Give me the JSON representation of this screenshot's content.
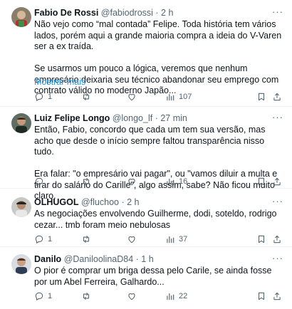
{
  "icons": {
    "reply": "reply-icon",
    "retweet": "retweet-icon",
    "like": "heart-icon",
    "views": "views-icon",
    "bookmark": "bookmark-icon",
    "share": "share-icon",
    "more": "more-icon"
  },
  "colors": {
    "text": "#0f1419",
    "secondary": "#536471",
    "link": "#1d9bf0",
    "divider": "#eff3f4"
  },
  "tweets": [
    {
      "name": "Fabio De Rossi",
      "handle": "@fabiodrossi",
      "sep": " · ",
      "time": "2 h",
      "paragraphs": [
        "Não vejo como “mal contada” Felipe. Toda história tem vários lados, porém aqui a grande maioria compra a ideia do V-Varen ser a ex traída.",
        "Se usarmos um pouco a lógica, veremos que nenhum empresário deixaria seu técnico abandonar seu emprego com contrato válido no moderno Japão..."
      ],
      "show_more": "Mostrar mais",
      "replies": "1",
      "retweets": "",
      "likes": "",
      "views": "107"
    },
    {
      "name": "Luiz Felipe Longo",
      "handle": "@longo_lf",
      "sep": " · ",
      "time": "27 min",
      "paragraphs": [
        "Então, Fabio, concordo que cada um tem sua versão, mas acho que desde o início sempre faltou transparência nisso tudo.",
        "Era falar: \"o empresário vai pagar\", ou \"vamos diluir a multa e tirar do salário do Carille\", algo assim, sabe? Não ficou muito claro."
      ],
      "replies": "",
      "retweets": "",
      "likes": "",
      "views": "16"
    },
    {
      "name": "OLHUGOL",
      "handle": "@fluchoo",
      "sep": " · ",
      "time": "2 h",
      "paragraphs": [
        "As negociações envolvendo Guilherme, dodi, soteldo, rodrigo cezar... tmb foram meio nebulosas"
      ],
      "replies": "1",
      "retweets": "",
      "likes": "",
      "views": "37"
    },
    {
      "name": "Danilo",
      "handle": "@DaniloolinaD84",
      "sep": " · ",
      "time": "1 h",
      "paragraphs": [
        "O pior é comprar um briga dessa pelo Carile, se ainda fosse por um Abel Ferreira, Galhardo..."
      ],
      "replies": "1",
      "retweets": "",
      "likes": "",
      "views": "22"
    }
  ]
}
